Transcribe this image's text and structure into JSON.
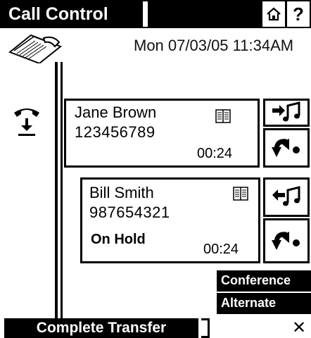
{
  "titlebar": {
    "title": "Call Control",
    "home_icon": "home-icon",
    "help_label": "?"
  },
  "header": {
    "datetime": "Mon 07/03/05 11:34AM",
    "phone_icon": "desk-phone-icon"
  },
  "handset_icon": "handset-hangup-icon",
  "calls": [
    {
      "name": "Jane Brown",
      "number": "123456789",
      "status": "",
      "time": "00:24",
      "phonebook_icon": "phonebook-icon",
      "actions": [
        "music-hold-out-icon",
        "transfer-arrow-icon"
      ]
    },
    {
      "name": "Bill Smith",
      "number": "987654321",
      "status": "On Hold",
      "time": "00:24",
      "phonebook_icon": "phonebook-icon",
      "actions": [
        "music-hold-in-icon",
        "transfer-arrow-icon"
      ]
    }
  ],
  "menu": {
    "conference_label": "Conference",
    "alternate_label": "Alternate"
  },
  "footer": {
    "complete_transfer_label": "Complete Transfer",
    "close_label": "✕"
  },
  "colors": {
    "background": "#ffffff",
    "foreground": "#000000"
  }
}
